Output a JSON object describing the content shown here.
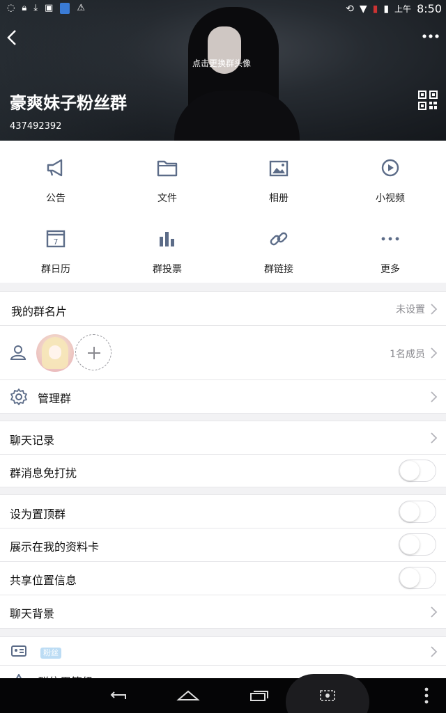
{
  "status_bar": {
    "left_icons": [
      "sync-icon",
      "lock-icon",
      "download-icon",
      "image-icon",
      "app-icon",
      "warning-icon"
    ],
    "right_icons": [
      "rotate-icon",
      "wifi-icon",
      "signal-icon",
      "battery-icon"
    ],
    "ampm": "上午",
    "time": "8:50"
  },
  "header": {
    "avatar_hint": "点击更换群头像",
    "group_name": "豪爽妹子粉丝群",
    "group_id": "437492392"
  },
  "grid": {
    "items": [
      {
        "label": "公告",
        "icon": "megaphone-icon"
      },
      {
        "label": "文件",
        "icon": "folder-icon"
      },
      {
        "label": "相册",
        "icon": "album-icon"
      },
      {
        "label": "小视频",
        "icon": "video-icon"
      },
      {
        "label": "群日历",
        "icon": "calendar-icon"
      },
      {
        "label": "群投票",
        "icon": "bar-chart-icon"
      },
      {
        "label": "群链接",
        "icon": "link-icon"
      },
      {
        "label": "更多",
        "icon": "more-icon"
      }
    ],
    "calendar_day": "7"
  },
  "card": {
    "title": "我的群名片",
    "value": "未设置"
  },
  "members": {
    "count_label": "1名成员"
  },
  "manage": {
    "title": "管理群"
  },
  "chat": {
    "history": "聊天记录",
    "mute": "群消息免打扰"
  },
  "settings": {
    "pin": "设为置顶群",
    "show_profile": "展示在我的资料卡",
    "share_location": "共享位置信息",
    "background": "聊天背景"
  },
  "fans": {
    "badge": "粉丝",
    "cut_label": "群信用等级"
  },
  "colors": {
    "accent": "#5c6c88",
    "badge": "#bcdcf4",
    "navbar": "#050506"
  }
}
